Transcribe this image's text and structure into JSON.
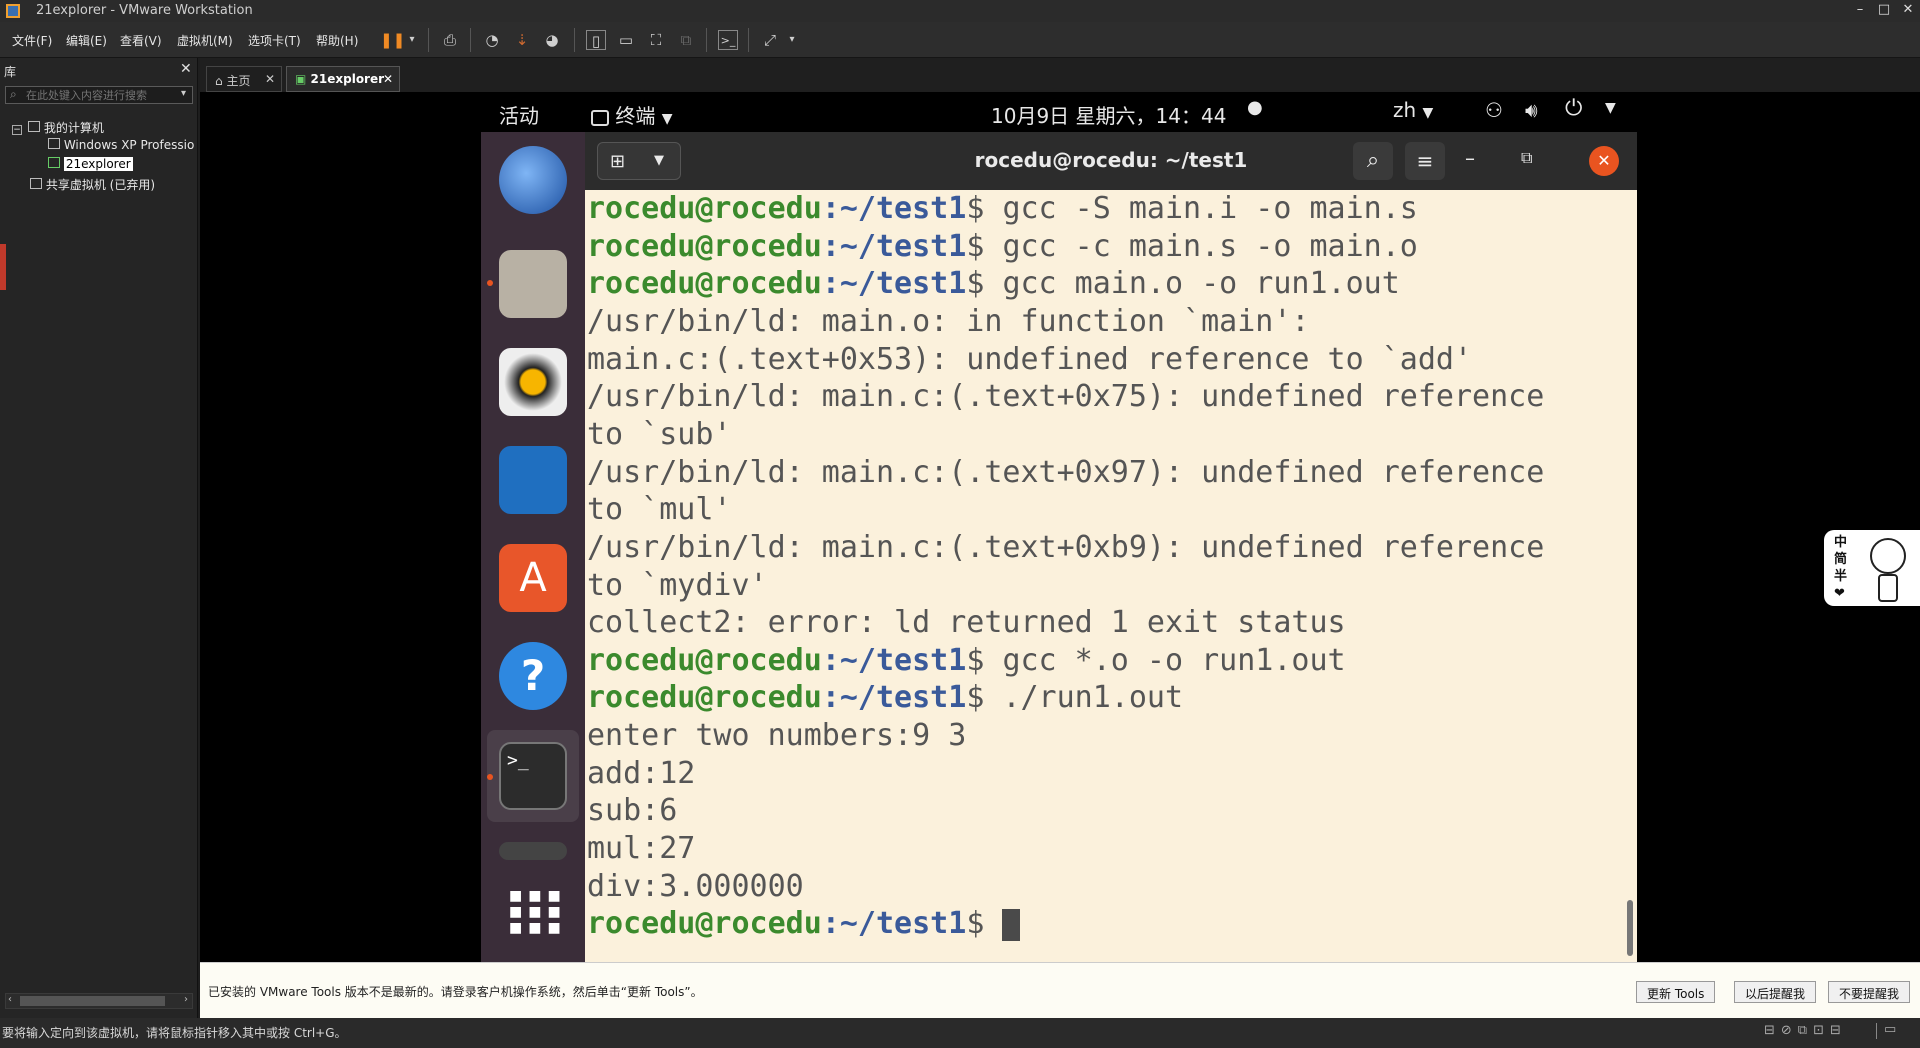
{
  "window": {
    "title": "21explorer - VMware Workstation",
    "controls": [
      "–",
      "□",
      "✕"
    ]
  },
  "menu": [
    "文件(F)",
    "编辑(E)",
    "查看(V)",
    "虚拟机(M)",
    "选项卡(T)",
    "帮助(H)"
  ],
  "library": {
    "title": "库",
    "search_placeholder": "在此处键入内容进行搜索",
    "tree": {
      "root": "我的计算机",
      "children": [
        "Windows XP Professio",
        "21explorer"
      ],
      "shared": "共享虚拟机 (已弃用)"
    }
  },
  "tabs": [
    {
      "label": "主页",
      "active": false
    },
    {
      "label": "21explorer",
      "active": true
    }
  ],
  "ubuntu": {
    "activities": "活动",
    "app_menu": "终端",
    "clock": "10月9日 星期六，14：44",
    "lang": "zh",
    "terminal_title": "rocedu@rocedu: ~/test1",
    "prompt_user": "rocedu@rocedu",
    "prompt_path": ":~/test1",
    "prompt_sym": "$ ",
    "lines": [
      {
        "type": "cmd",
        "text": "gcc -S main.i -o main.s"
      },
      {
        "type": "cmd",
        "text": "gcc -c main.s -o main.o"
      },
      {
        "type": "cmd",
        "text": "gcc main.o -o run1.out"
      },
      {
        "type": "out",
        "text": "/usr/bin/ld: main.o: in function `main':"
      },
      {
        "type": "out",
        "text": "main.c:(.text+0x53): undefined reference to `add'"
      },
      {
        "type": "out",
        "text": "/usr/bin/ld: main.c:(.text+0x75): undefined reference"
      },
      {
        "type": "out",
        "text": "to `sub'"
      },
      {
        "type": "out",
        "text": "/usr/bin/ld: main.c:(.text+0x97): undefined reference"
      },
      {
        "type": "out",
        "text": "to `mul'"
      },
      {
        "type": "out",
        "text": "/usr/bin/ld: main.c:(.text+0xb9): undefined reference"
      },
      {
        "type": "out",
        "text": "to `mydiv'"
      },
      {
        "type": "out",
        "text": "collect2: error: ld returned 1 exit status"
      },
      {
        "type": "cmd",
        "text": "gcc *.o -o run1.out"
      },
      {
        "type": "cmd",
        "text": "./run1.out"
      },
      {
        "type": "out",
        "text": "enter two numbers:9 3"
      },
      {
        "type": "out",
        "text": "add:12"
      },
      {
        "type": "out",
        "text": "sub:6"
      },
      {
        "type": "out",
        "text": "mul:27"
      },
      {
        "type": "out",
        "text": "div:3.000000"
      },
      {
        "type": "cmd",
        "text": ""
      }
    ]
  },
  "notification": {
    "text": "已安装的 VMware Tools 版本不是最新的。请登录客户机操作系统，然后单击“更新 Tools”。",
    "buttons": [
      "更新 Tools",
      "以后提醒我",
      "不要提醒我"
    ]
  },
  "status": "要将输入定向到该虚拟机，请将鼠标指针移入其中或按 Ctrl+G。",
  "ime": {
    "lines": [
      "中",
      "简",
      "半",
      "❤"
    ]
  },
  "colors": {
    "dock": "#3a2d39",
    "terminal_bg": "#fbf1dc",
    "prompt_user": "#3b8a2d",
    "prompt_path": "#3a5a9a",
    "close_btn": "#e95420"
  }
}
